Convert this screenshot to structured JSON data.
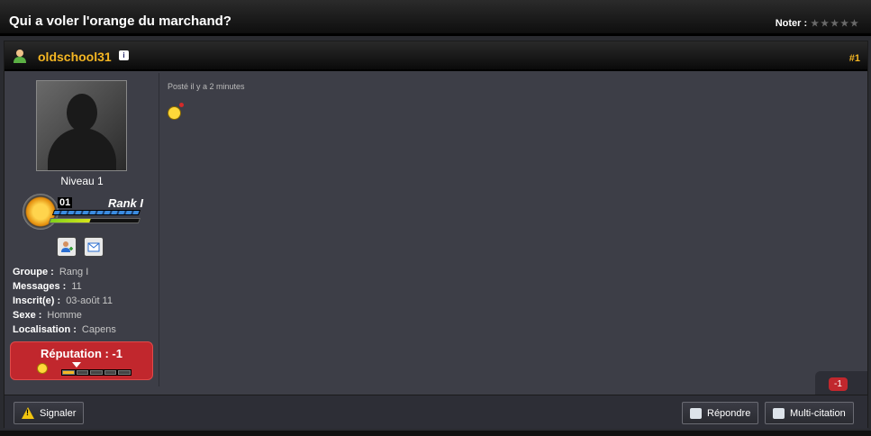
{
  "topic": {
    "title": "Qui a voler l'orange du marchand?",
    "rate_label": "Noter :",
    "stars": "★★★★★"
  },
  "post": {
    "author": "oldschool31",
    "number": "#1",
    "posted": "Posté il y a 2 minutes",
    "level": "Niveau 1",
    "rank_number": "01",
    "rank_name": "Rank I",
    "rank_progress": 0.45,
    "stats": [
      {
        "key": "Groupe :",
        "value": "Rang I"
      },
      {
        "key": "Messages :",
        "value": "11"
      },
      {
        "key": "Inscrit(e) :",
        "value": "03-août 11"
      },
      {
        "key": "Sexe :",
        "value": "Homme"
      },
      {
        "key": "Localisation :",
        "value": "Capens"
      }
    ],
    "reputation_label": "Réputation : -1",
    "reputation_count": "-1"
  },
  "footer": {
    "report": "Signaler",
    "reply": "Répondre",
    "multiquote": "Multi-citation"
  },
  "colors": {
    "accent": "#f4b623",
    "reputation_bg": "#c1272d",
    "post_bg": "#3d3e47"
  }
}
